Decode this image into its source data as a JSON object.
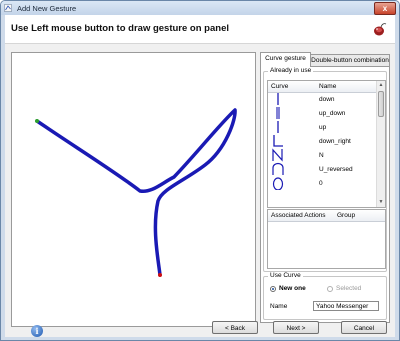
{
  "window": {
    "title": "Add New Gesture",
    "close_glyph": "x"
  },
  "header": {
    "heading": "Use Left mouse button to draw gesture on panel",
    "logo_icon": "mouse-logo-icon"
  },
  "canvas": {
    "stroke_color": "#1a1ab4",
    "start_color": "#2ea02e",
    "end_color": "#d01010"
  },
  "tabs": [
    "Curve gesture",
    "Double-button combination"
  ],
  "already_in_use": {
    "label": "Already in use",
    "columns": [
      "Curve",
      "Name"
    ],
    "items": [
      {
        "name": "down",
        "icon": "down-curve-icon"
      },
      {
        "name": "up_down",
        "icon": "up-down-curve-icon"
      },
      {
        "name": "up",
        "icon": "up-curve-icon"
      },
      {
        "name": "down_right",
        "icon": "down-right-curve-icon"
      },
      {
        "name": "N",
        "icon": "n-curve-icon"
      },
      {
        "name": "U_reversed",
        "icon": "u-reversed-curve-icon"
      },
      {
        "name": "0",
        "icon": "zero-curve-icon"
      }
    ]
  },
  "actions_table": {
    "columns": [
      "Associated Actions",
      "Group"
    ]
  },
  "use_curve": {
    "label": "Use Curve",
    "options": [
      {
        "label": "New one",
        "selected": true
      },
      {
        "label": "Selected",
        "selected": false
      }
    ],
    "name_label": "Name",
    "name_value": "Yahoo Messenger"
  },
  "footer": {
    "back": "< Back",
    "next": "Next >",
    "cancel": "Cancel",
    "info_glyph": "i"
  }
}
